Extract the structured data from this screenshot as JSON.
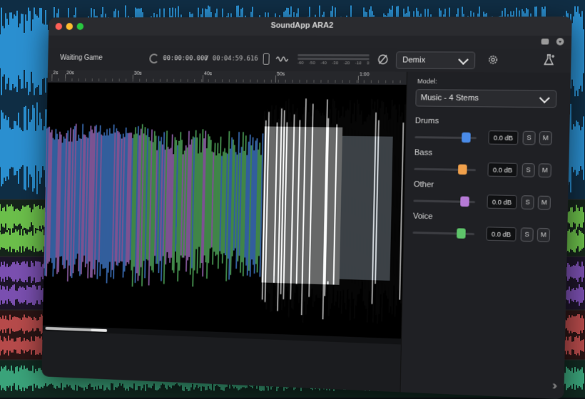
{
  "window": {
    "title": "SoundApp ARA2"
  },
  "toolbar": {
    "song_title": "Waiting Game",
    "current_time": "00:00:00.000",
    "total_time": "/ 00:04:59.616",
    "vu_scale": [
      "-60",
      "-50",
      "-40",
      "-30",
      "-20",
      "-10",
      "0"
    ],
    "algorithm": "Demix"
  },
  "ruler": {
    "labels": [
      "2s",
      "20s",
      "30s",
      "40s",
      "50s",
      "1:00"
    ]
  },
  "panel": {
    "model_label": "Model:",
    "model_value": "Music - 4 Stems",
    "stems": [
      {
        "name": "Drums",
        "db": "0.0 dB",
        "solo": "S",
        "mute": "M",
        "color": "#4a8be8",
        "level": 0.83
      },
      {
        "name": "Bass",
        "db": "0.0 dB",
        "solo": "S",
        "mute": "M",
        "color": "#f0a04b",
        "level": 0.78
      },
      {
        "name": "Other",
        "db": "0.0 dB",
        "solo": "S",
        "mute": "M",
        "color": "#b67ad6",
        "level": 0.83
      },
      {
        "name": "Voice",
        "db": "0.0 dB",
        "solo": "S",
        "mute": "M",
        "color": "#5ec46a",
        "level": 0.78
      }
    ]
  },
  "colors": {
    "drums": "#4a8be8",
    "bass": "#f0a04b",
    "other": "#b67ad6",
    "voice": "#5ec46a",
    "background_blue": "#2a8fd0",
    "background_green": "#6bbf4a",
    "background_purple": "#7a4fb0",
    "background_red": "#b64a4a",
    "background_teal": "#3aa37a"
  }
}
